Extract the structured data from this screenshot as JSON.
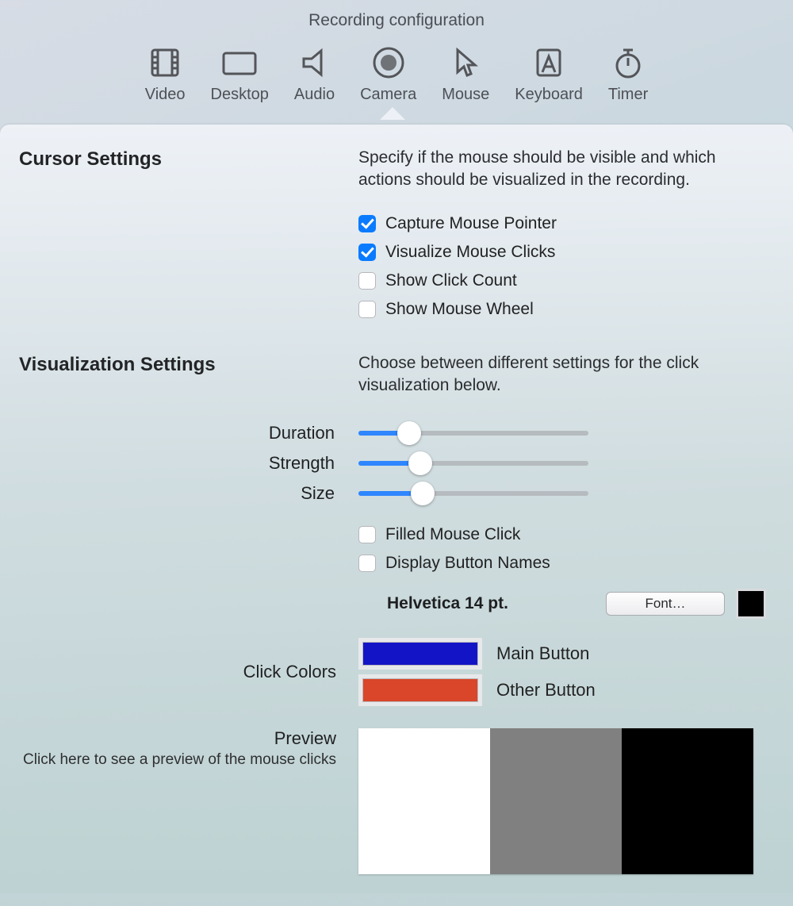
{
  "window": {
    "title": "Recording configuration"
  },
  "toolbar": {
    "items": [
      {
        "label": "Video",
        "icon": "video-icon"
      },
      {
        "label": "Desktop",
        "icon": "desktop-icon"
      },
      {
        "label": "Audio",
        "icon": "audio-icon"
      },
      {
        "label": "Camera",
        "icon": "camera-icon"
      },
      {
        "label": "Mouse",
        "icon": "mouse-icon",
        "selected": true
      },
      {
        "label": "Keyboard",
        "icon": "keyboard-icon"
      },
      {
        "label": "Timer",
        "icon": "timer-icon"
      }
    ]
  },
  "cursor": {
    "heading": "Cursor Settings",
    "description": "Specify if the mouse should be visible and which actions should be visualized in the recording.",
    "options": [
      {
        "label": "Capture Mouse Pointer",
        "checked": true
      },
      {
        "label": "Visualize Mouse Clicks",
        "checked": true
      },
      {
        "label": "Show Click Count",
        "checked": false
      },
      {
        "label": "Show Mouse Wheel",
        "checked": false
      }
    ]
  },
  "visualization": {
    "heading": "Visualization Settings",
    "description": "Choose between different settings for the click visualization below.",
    "sliders": {
      "duration": {
        "label": "Duration",
        "value": 22
      },
      "strength": {
        "label": "Strength",
        "value": 27
      },
      "size": {
        "label": "Size",
        "value": 28
      }
    },
    "options": [
      {
        "label": "Filled Mouse Click",
        "checked": false
      },
      {
        "label": "Display Button Names",
        "checked": false
      }
    ],
    "font": {
      "display": "Helvetica 14 pt.",
      "button": "Font…",
      "swatch_color": "#000000"
    },
    "click_colors": {
      "label": "Click Colors",
      "main": {
        "label": "Main Button",
        "color": "#1414C7"
      },
      "other": {
        "label": "Other Button",
        "color": "#D9462A"
      }
    },
    "preview": {
      "label": "Preview",
      "subtext": "Click here to see a preview of the mouse clicks",
      "panes": [
        "#FFFFFF",
        "#808080",
        "#000000"
      ]
    }
  }
}
